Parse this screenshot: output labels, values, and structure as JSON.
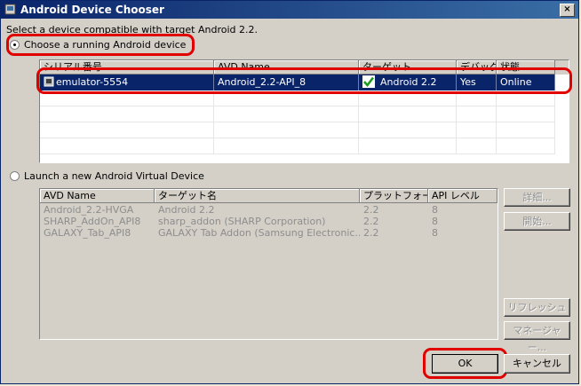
{
  "window": {
    "title": "Android Device Chooser",
    "close_glyph": "×"
  },
  "info_text": "Select a device compatible with target Android 2.2.",
  "running": {
    "radio_label": "Choose a running Android device",
    "columns": [
      "シリアル番号",
      "AVD Name",
      "ターゲット",
      "デバッグ",
      "状態"
    ],
    "rows": [
      {
        "serial": "emulator-5554",
        "avd": "Android_2.2-API_8",
        "target": "Android 2.2",
        "debug": "Yes",
        "state": "Online"
      }
    ]
  },
  "launch": {
    "radio_label": "Launch a new Android Virtual Device",
    "columns": [
      "AVD Name",
      "ターゲット名",
      "プラットフォー...",
      "API レベル"
    ],
    "rows": [
      {
        "name": "Android_2.2-HVGA",
        "target": "Android 2.2",
        "platform": "2.2",
        "api": "8"
      },
      {
        "name": "SHARP_AddOn_API8",
        "target": "sharp_addon (SHARP Corporation)",
        "platform": "2.2",
        "api": "8"
      },
      {
        "name": "GALAXY_Tab_API8",
        "target": "GALAXY Tab Addon (Samsung Electronic...",
        "platform": "2.2",
        "api": "8"
      }
    ],
    "buttons": {
      "details": "詳細...",
      "start": "開始...",
      "refresh": "リフレッシュ",
      "manager": "マネージャー..."
    }
  },
  "footer": {
    "ok": "OK",
    "cancel": "キャンセル"
  },
  "colors": {
    "selection": "#0a246a",
    "highlight": "#e00000",
    "titlebar": "#0a246a"
  }
}
